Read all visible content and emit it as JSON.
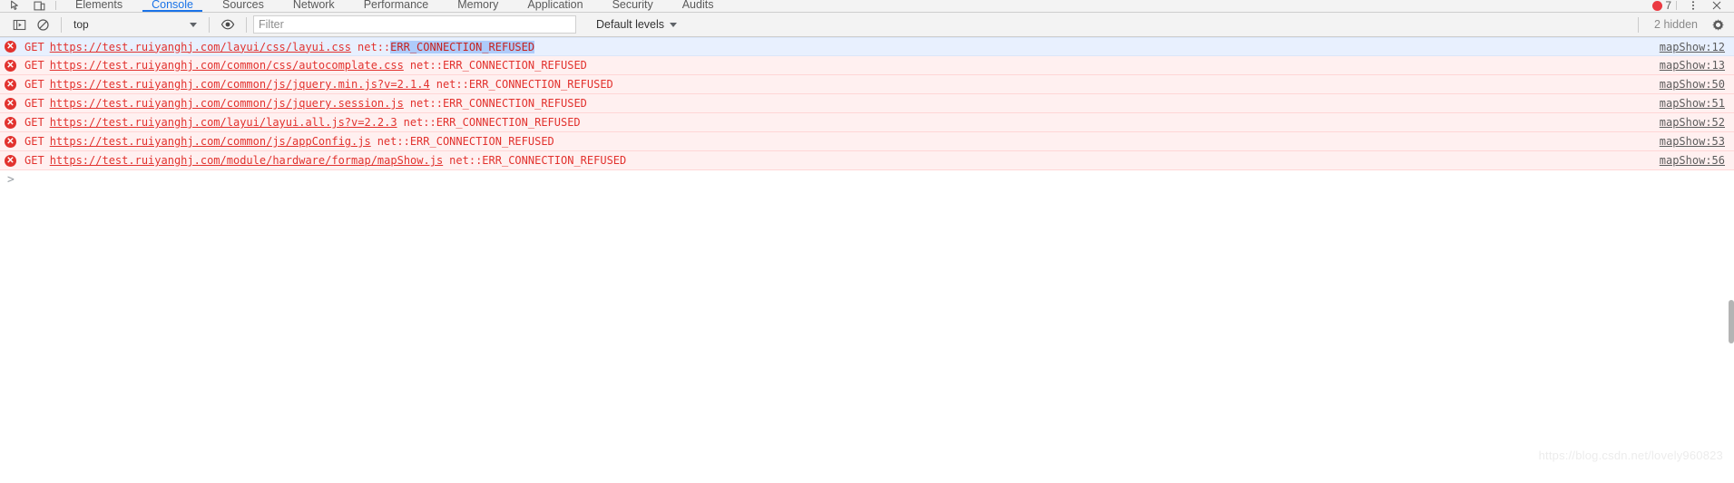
{
  "window": {
    "title": "Chrome DevTools - Console",
    "error_badge_count": "7"
  },
  "tabs": [
    {
      "label": "Elements",
      "active": false
    },
    {
      "label": "Console",
      "active": true
    },
    {
      "label": "Sources",
      "active": false
    },
    {
      "label": "Network",
      "active": false
    },
    {
      "label": "Performance",
      "active": false
    },
    {
      "label": "Memory",
      "active": false
    },
    {
      "label": "Application",
      "active": false
    },
    {
      "label": "Security",
      "active": false
    },
    {
      "label": "Audits",
      "active": false
    }
  ],
  "tabstrip_icons": {
    "inspect": "inspect-element-icon",
    "device": "device-toolbar-icon",
    "more": "more-tabs-icon",
    "close": "close-devtools-icon"
  },
  "toolbar": {
    "sidebar_toggle_icon": "console-sidebar-icon",
    "clear_icon": "clear-console-icon",
    "context_value": "top",
    "live_expression_icon": "eye-icon",
    "filter_placeholder": "Filter",
    "filter_value": "",
    "levels_label": "Default levels",
    "hidden_label": "2 hidden",
    "settings_icon": "gear-icon"
  },
  "console": {
    "prompt_symbol": ">",
    "messages": [
      {
        "level": "error",
        "icon_glyph": "✕",
        "method": "GET",
        "url": "https://test.ruiyanghj.com/layui/css/layui.css",
        "net_prefix": "net::",
        "error": "ERR_CONNECTION_REFUSED",
        "highlighted": true,
        "selected": true,
        "source": "mapShow:12"
      },
      {
        "level": "error",
        "icon_glyph": "✕",
        "method": "GET",
        "url": "https://test.ruiyanghj.com/common/css/autocomplate.css",
        "net_prefix": "net::",
        "error": "ERR_CONNECTION_REFUSED",
        "highlighted": false,
        "selected": false,
        "source": "mapShow:13"
      },
      {
        "level": "error",
        "icon_glyph": "✕",
        "method": "GET",
        "url": "https://test.ruiyanghj.com/common/js/jquery.min.js?v=2.1.4",
        "net_prefix": "net::",
        "error": "ERR_CONNECTION_REFUSED",
        "highlighted": false,
        "selected": false,
        "source": "mapShow:50"
      },
      {
        "level": "error",
        "icon_glyph": "✕",
        "method": "GET",
        "url": "https://test.ruiyanghj.com/common/js/jquery.session.js",
        "net_prefix": "net::",
        "error": "ERR_CONNECTION_REFUSED",
        "highlighted": false,
        "selected": false,
        "source": "mapShow:51"
      },
      {
        "level": "error",
        "icon_glyph": "✕",
        "method": "GET",
        "url": "https://test.ruiyanghj.com/layui/layui.all.js?v=2.2.3",
        "net_prefix": "net::",
        "error": "ERR_CONNECTION_REFUSED",
        "highlighted": false,
        "selected": false,
        "source": "mapShow:52"
      },
      {
        "level": "error",
        "icon_glyph": "✕",
        "method": "GET",
        "url": "https://test.ruiyanghj.com/common/js/appConfig.js",
        "net_prefix": "net::",
        "error": "ERR_CONNECTION_REFUSED",
        "highlighted": false,
        "selected": false,
        "source": "mapShow:53"
      },
      {
        "level": "error",
        "icon_glyph": "✕",
        "method": "GET",
        "url": "https://test.ruiyanghj.com/module/hardware/formap/mapShow.js",
        "net_prefix": "net::",
        "error": "ERR_CONNECTION_REFUSED",
        "highlighted": false,
        "selected": false,
        "source": "mapShow:56"
      }
    ]
  },
  "watermark": {
    "text": "https://blog.csdn.net/lovely960823"
  },
  "colors": {
    "error_text": "#e2322e",
    "error_row_bg": "#fff0f0",
    "selected_row_bg": "#e8f0fe",
    "selection_highlight": "#aecbfa",
    "accent": "#1a73e8",
    "toolbar_bg": "#f3f3f3"
  }
}
